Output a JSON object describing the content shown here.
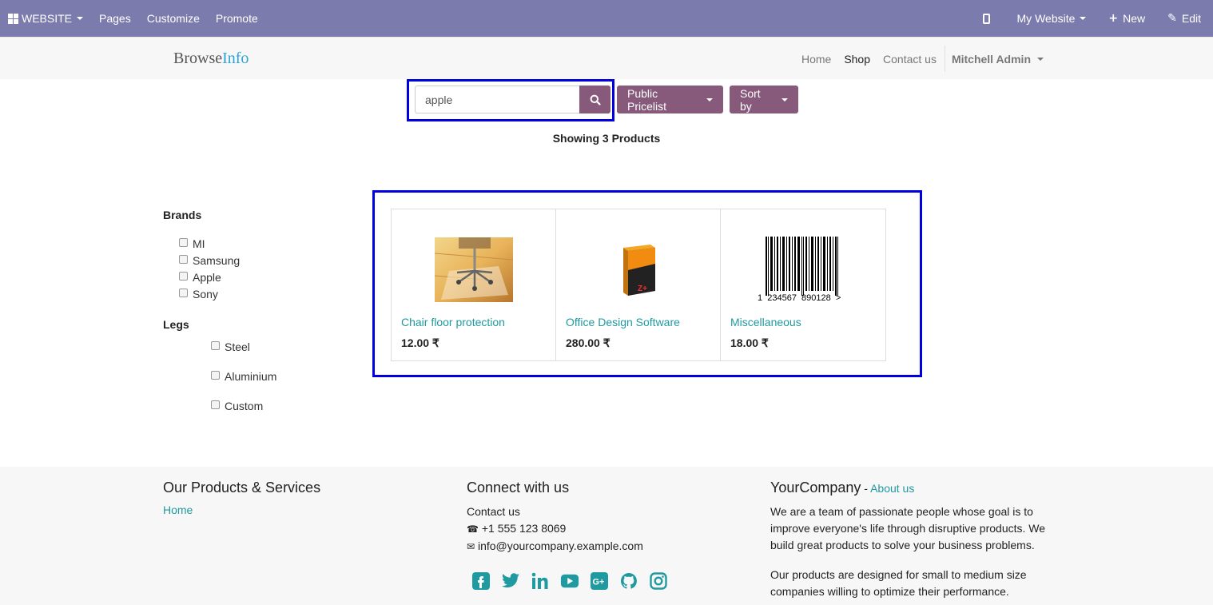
{
  "admin_bar": {
    "website_label": "WEBSITE",
    "pages_label": "Pages",
    "customize_label": "Customize",
    "promote_label": "Promote",
    "my_website_label": "My Website",
    "new_label": "New",
    "edit_label": "Edit"
  },
  "header": {
    "logo_part1": "Browse",
    "logo_part2": "Info",
    "nav": [
      "Home",
      "Shop",
      "Contact us"
    ],
    "user": "Mitchell Admin"
  },
  "search": {
    "value": "apple",
    "pricelist_label": "Public Pricelist",
    "sortby_label": "Sort by"
  },
  "results_text": "Showing 3 Products",
  "filters": {
    "brands_title": "Brands",
    "brands": [
      "MI",
      "Samsung",
      "Apple",
      "Sony"
    ],
    "legs_title": "Legs",
    "legs": [
      "Steel",
      "Aluminium",
      "Custom"
    ]
  },
  "products": [
    {
      "name": "Chair floor protection",
      "price": "12.00 ₹"
    },
    {
      "name": "Office Design Software",
      "price": "280.00 ₹"
    },
    {
      "name": "Miscellaneous",
      "price": "18.00 ₹",
      "barcode_text": "1  234567  890128  >"
    }
  ],
  "footer": {
    "col1_title": "Our Products & Services",
    "col1_link": "Home",
    "col2_title": "Connect with us",
    "col2_link": "Contact us",
    "phone": "+1 555 123 8069",
    "email": "info@yourcompany.example.com",
    "col3_title": "YourCompany",
    "col3_dash": " - ",
    "col3_link": "About us",
    "about_p1": "We are a team of passionate people whose goal is to improve everyone's life through disruptive products. We build great products to solve your business problems.",
    "about_p2": "Our products are designed for small to medium size companies willing to optimize their performance."
  },
  "colors": {
    "admin_bar": "#7c7bad",
    "button": "#875a7b",
    "link": "#1f9aa0",
    "highlight_box": "#0000e0"
  },
  "icons": [
    "grid-icon",
    "phone-icon",
    "plus-icon",
    "pencil-icon",
    "search-icon",
    "facebook-icon",
    "twitter-icon",
    "linkedin-icon",
    "youtube-icon",
    "google-plus-icon",
    "github-icon",
    "instagram-icon"
  ]
}
